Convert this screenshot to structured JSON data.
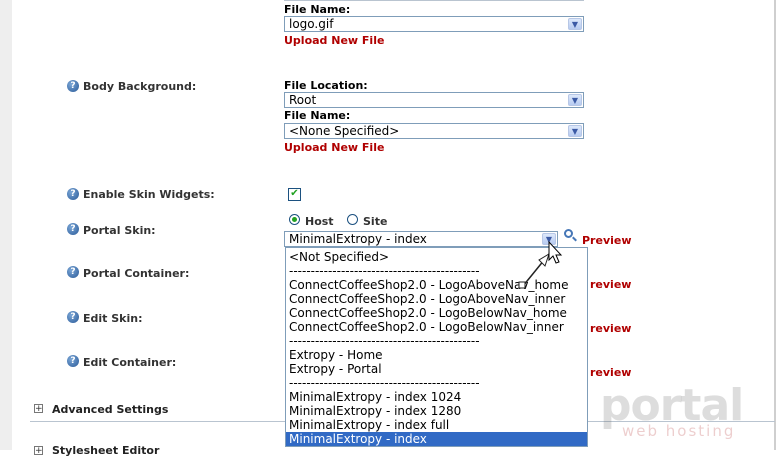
{
  "top_file": {
    "file_name_label": "File Name:",
    "file_name_value": "logo.gif",
    "upload_link": "Upload New File"
  },
  "body_background": {
    "label": "Body Background:",
    "file_location_label": "File Location:",
    "file_location_value": "Root",
    "file_name_label": "File Name:",
    "file_name_value": "<None Specified>",
    "upload_link": "Upload New File"
  },
  "skin_widgets": {
    "label": "Enable Skin Widgets:",
    "checked": true,
    "check_glyph": "✔"
  },
  "portal_skin": {
    "label": "Portal Skin:",
    "radio_host": "Host",
    "radio_site": "Site",
    "selected": "MinimalExtropy - index",
    "preview": "Preview"
  },
  "portal_container": {
    "label": "Portal Container:",
    "preview": "review"
  },
  "edit_skin": {
    "label": "Edit Skin:",
    "preview": "review"
  },
  "edit_container": {
    "label": "Edit Container:",
    "preview": "review"
  },
  "dropdown_options": [
    "<Not Specified>",
    "--------------------------------------------",
    "ConnectCoffeeShop2.0 - LogoAboveNav_home",
    "ConnectCoffeeShop2.0 - LogoAboveNav_inner",
    "ConnectCoffeeShop2.0 - LogoBelowNav_home",
    "ConnectCoffeeShop2.0 - LogoBelowNav_inner",
    "--------------------------------------------",
    "Extropy - Home",
    "Extropy - Portal",
    "--------------------------------------------",
    "MinimalExtropy - index 1024",
    "MinimalExtropy - index 1280",
    "MinimalExtropy - index full",
    "MinimalExtropy - index"
  ],
  "advanced_settings": {
    "label": "Advanced Settings",
    "toggle": "+"
  },
  "next_section": {
    "label": "Stylesheet Editor",
    "toggle": "+"
  },
  "watermark": {
    "main": "portal",
    "sub": "web hosting"
  },
  "colors": {
    "link": "#b00000",
    "selection": "#316ac5",
    "help_icon": "#2a5a98"
  }
}
